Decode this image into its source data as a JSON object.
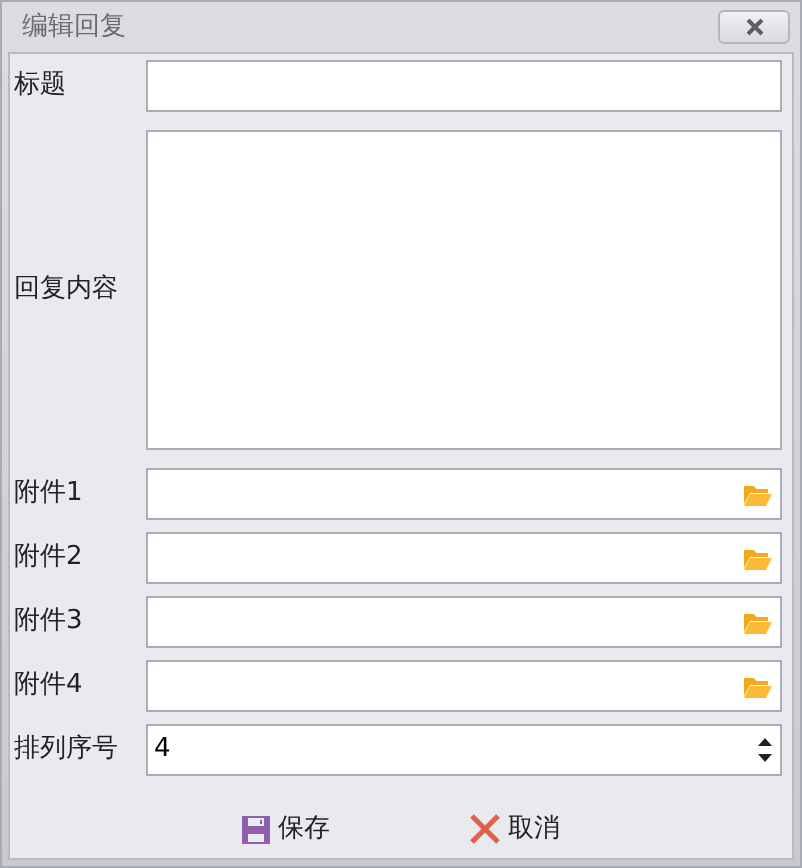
{
  "window": {
    "title": "编辑回复"
  },
  "fields": [
    {
      "kind": "text",
      "label": "标题"
    },
    {
      "kind": "textarea",
      "label": "回复内容"
    },
    {
      "kind": "file",
      "label": "附件1"
    },
    {
      "kind": "file",
      "label": "附件2"
    },
    {
      "kind": "file",
      "label": "附件3"
    },
    {
      "kind": "file",
      "label": "附件4"
    },
    {
      "kind": "number",
      "label": "排列序号",
      "value": "4"
    }
  ],
  "buttons": [
    {
      "kind": "save",
      "label": "保存"
    },
    {
      "kind": "cancel",
      "label": "取消"
    }
  ]
}
